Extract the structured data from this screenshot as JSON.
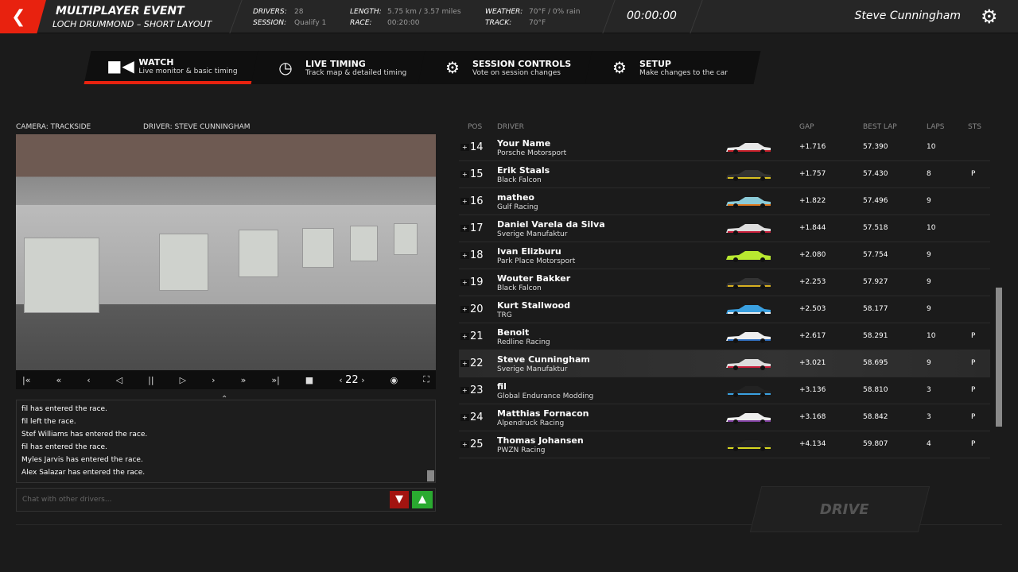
{
  "header": {
    "back_icon": "chevron-left-icon",
    "title": "MULTIPLAYER EVENT",
    "subtitle": "LOCH DRUMMOND – SHORT LAYOUT",
    "drivers_label": "DRIVERS:",
    "drivers": "28",
    "session_label": "SESSION:",
    "session": "Qualify 1",
    "length_label": "LENGTH:",
    "length": "5.75 km / 3.57 miles",
    "race_label": "RACE:",
    "race": "00:20:00",
    "weather_label": "WEATHER:",
    "weather": "70°F / 0% rain",
    "track_label": "TRACK:",
    "track": "70°F",
    "clock": "00:00:00",
    "user": "Steve Cunningham",
    "accent": "#e8220f"
  },
  "tabs": [
    {
      "title": "WATCH",
      "subtitle": "Live monitor & basic timing",
      "icon": "video-camera-icon",
      "active": true
    },
    {
      "title": "LIVE TIMING",
      "subtitle": "Track map & detailed timing",
      "icon": "stopwatch-icon"
    },
    {
      "title": "SESSION CONTROLS",
      "subtitle": "Vote on session changes",
      "icon": "gear-clock-icon"
    },
    {
      "title": "SETUP",
      "subtitle": "Make changes to the car",
      "icon": "wrench-gear-icon"
    }
  ],
  "monitor": {
    "camera": "CAMERA: TRACKSIDE",
    "driver": "DRIVER: STEVE CUNNINGHAM",
    "car_number": "22"
  },
  "log": [
    "fil has entered the race.",
    "fil left the race.",
    "Stef Williams has entered the race.",
    "fil has entered the race.",
    "Myles Jarvis has entered the race.",
    "Alex Salazar has entered the race."
  ],
  "chat": {
    "placeholder": "Chat with other drivers..."
  },
  "table": {
    "headers": {
      "pos": "POS",
      "driver": "DRIVER",
      "gap": "GAP",
      "best": "BEST LAP",
      "laps": "LAPS",
      "sts": "STS"
    },
    "rows": [
      {
        "pos": "14",
        "name": "Your Name",
        "team": "Porsche Motorsport",
        "gap": "+1.716",
        "best": "57.390",
        "laps": "10",
        "sts": "",
        "car": "#e8e8e8",
        "car2": "#c8202a"
      },
      {
        "pos": "15",
        "name": "Erik Staals",
        "team": "Black Falcon",
        "gap": "+1.757",
        "best": "57.430",
        "laps": "8",
        "sts": "P",
        "car": "#333",
        "car2": "#d8c020"
      },
      {
        "pos": "16",
        "name": "matheo",
        "team": "Gulf Racing",
        "gap": "+1.822",
        "best": "57.496",
        "laps": "9",
        "sts": "",
        "car": "#8ccbd8",
        "car2": "#e07a20"
      },
      {
        "pos": "17",
        "name": "Daniel Varela da Silva",
        "team": "Sverige Manufaktur",
        "gap": "+1.844",
        "best": "57.518",
        "laps": "10",
        "sts": "",
        "car": "#ddd",
        "car2": "#c81e3a"
      },
      {
        "pos": "18",
        "name": "Ivan Elizburu",
        "team": "Park Place Motorsport",
        "gap": "+2.080",
        "best": "57.754",
        "laps": "9",
        "sts": "",
        "car": "#b8e830",
        "car2": "#b8e830"
      },
      {
        "pos": "19",
        "name": "Wouter Bakker",
        "team": "Black Falcon",
        "gap": "+2.253",
        "best": "57.927",
        "laps": "9",
        "sts": "",
        "car": "#333",
        "car2": "#d8b020"
      },
      {
        "pos": "20",
        "name": "Kurt Stallwood",
        "team": "TRG",
        "gap": "+2.503",
        "best": "58.177",
        "laps": "9",
        "sts": "",
        "car": "#3aa0e0",
        "car2": "#eee"
      },
      {
        "pos": "21",
        "name": "Benoit",
        "team": "Redline Racing",
        "gap": "+2.617",
        "best": "58.291",
        "laps": "10",
        "sts": "P",
        "car": "#eee",
        "car2": "#3070c0"
      },
      {
        "pos": "22",
        "name": "Steve Cunningham",
        "team": "Sverige Manufaktur",
        "gap": "+3.021",
        "best": "58.695",
        "laps": "9",
        "sts": "P",
        "car": "#ddd",
        "car2": "#c81e3a",
        "me": true
      },
      {
        "pos": "23",
        "name": "fil",
        "team": "Global Endurance Modding",
        "gap": "+3.136",
        "best": "58.810",
        "laps": "3",
        "sts": "P",
        "car": "#222",
        "car2": "#3aa0e0"
      },
      {
        "pos": "24",
        "name": "Matthias Fornacon",
        "team": "Alpendruck Racing",
        "gap": "+3.168",
        "best": "58.842",
        "laps": "3",
        "sts": "P",
        "car": "#eee",
        "car2": "#8040a0"
      },
      {
        "pos": "25",
        "name": "Thomas Johansen",
        "team": "PWZN Racing",
        "gap": "+4.134",
        "best": "59.807",
        "laps": "4",
        "sts": "P",
        "car": "#222",
        "car2": "#d8d820"
      }
    ]
  },
  "drive_label": "DRIVE"
}
